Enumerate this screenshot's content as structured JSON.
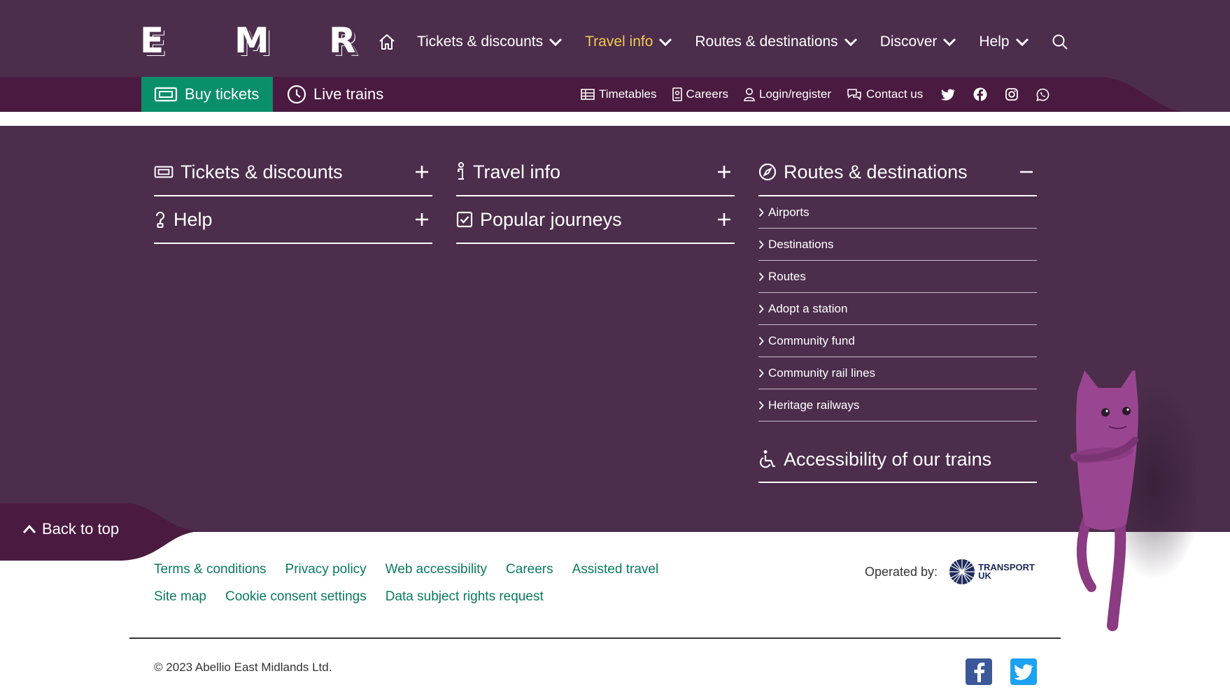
{
  "header": {
    "logo_letters": [
      "E",
      "M",
      "R"
    ],
    "nav": [
      {
        "label": "Tickets & discounts"
      },
      {
        "label": "Travel info"
      },
      {
        "label": "Routes & destinations"
      },
      {
        "label": "Discover"
      },
      {
        "label": "Help"
      }
    ],
    "buy_tickets": "Buy tickets",
    "live_trains": "Live trains",
    "util": {
      "timetables": "Timetables",
      "careers": "Careers",
      "login": "Login/register",
      "contact": "Contact us"
    }
  },
  "footer_menu": {
    "tickets": "Tickets & discounts",
    "travel": "Travel info",
    "routes": "Routes & destinations",
    "help": "Help",
    "popular": "Popular journeys",
    "routes_items": [
      "Airports",
      "Destinations",
      "Routes",
      "Adopt a station",
      "Community fund",
      "Community rail lines",
      "Heritage railways"
    ],
    "accessibility": "Accessibility of our trains"
  },
  "back_to_top": "Back to top",
  "links": {
    "row1": [
      "Terms & conditions",
      "Privacy policy",
      "Web accessibility",
      "Careers",
      "Assisted travel"
    ],
    "row2": [
      "Site map",
      "Cookie consent settings",
      "Data subject rights request"
    ]
  },
  "operated_by": "Operated by:",
  "operator_logo": {
    "line1": "TRANSPORT",
    "line2": "UK"
  },
  "copyright": "© 2023 Abellio East Midlands Ltd.",
  "colors": {
    "purple": "#4c2d4c",
    "dark_purple": "#4a1a40",
    "green": "#0a8f6b",
    "link_green": "#0a7a5e",
    "active_yellow": "#f1c84b"
  }
}
